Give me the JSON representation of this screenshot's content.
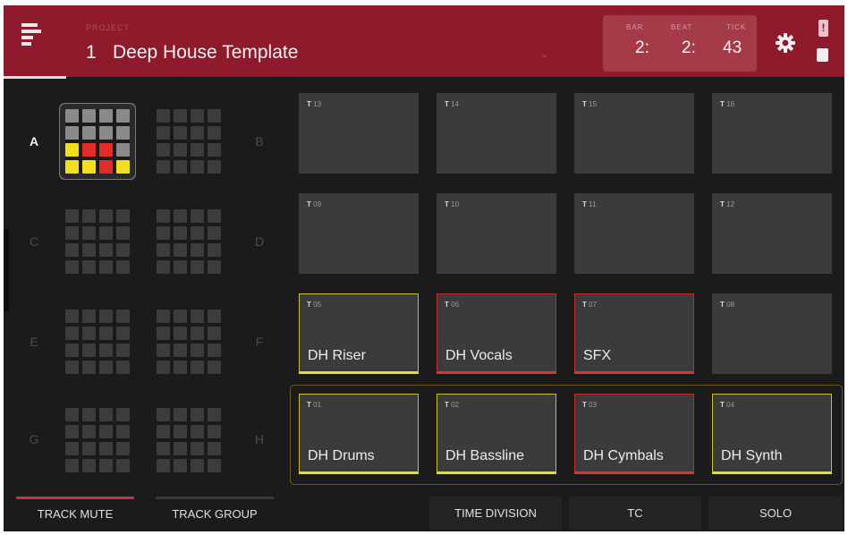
{
  "header": {
    "project_caption": "PROJECT",
    "project_number": "1",
    "project_name": "Deep House Template",
    "chevron": "⌄",
    "counter": {
      "bar_label": "BAR",
      "bar_value": "2:",
      "beat_label": "BEAT",
      "beat_value": "2:",
      "tick_label": "TICK",
      "tick_value": "43"
    },
    "alert_glyph": "!"
  },
  "banks": [
    {
      "letter": "A",
      "active": true
    },
    {
      "letter": "B",
      "active": false
    },
    {
      "letter": "C",
      "active": false
    },
    {
      "letter": "D",
      "active": false
    },
    {
      "letter": "E",
      "active": false
    },
    {
      "letter": "F",
      "active": false
    },
    {
      "letter": "G",
      "active": false
    },
    {
      "letter": "H",
      "active": false
    }
  ],
  "selected_bank_pad_colors": [
    "grey",
    "grey",
    "grey",
    "grey",
    "grey",
    "grey",
    "grey",
    "grey",
    "yellow",
    "red",
    "red",
    "grey",
    "yellow",
    "yellow",
    "red",
    "yellow"
  ],
  "pads": [
    {
      "t": "T",
      "num": "13",
      "name": "",
      "state": "off"
    },
    {
      "t": "T",
      "num": "14",
      "name": "",
      "state": "off"
    },
    {
      "t": "T",
      "num": "15",
      "name": "",
      "state": "off"
    },
    {
      "t": "T",
      "num": "16",
      "name": "",
      "state": "off"
    },
    {
      "t": "T",
      "num": "09",
      "name": "",
      "state": "off"
    },
    {
      "t": "T",
      "num": "10",
      "name": "",
      "state": "off"
    },
    {
      "t": "T",
      "num": "11",
      "name": "",
      "state": "off"
    },
    {
      "t": "T",
      "num": "12",
      "name": "",
      "state": "off"
    },
    {
      "t": "T",
      "num": "05",
      "name": "DH Riser",
      "state": "yellow"
    },
    {
      "t": "T",
      "num": "06",
      "name": "DH Vocals",
      "state": "red"
    },
    {
      "t": "T",
      "num": "07",
      "name": "SFX",
      "state": "red"
    },
    {
      "t": "T",
      "num": "08",
      "name": "",
      "state": "off"
    },
    {
      "t": "T",
      "num": "01",
      "name": "DH Drums",
      "state": "yellow"
    },
    {
      "t": "T",
      "num": "02",
      "name": "DH Bassline",
      "state": "yellow"
    },
    {
      "t": "T",
      "num": "03",
      "name": "DH Cymbals",
      "state": "red"
    },
    {
      "t": "T",
      "num": "04",
      "name": "DH Synth",
      "state": "yellow"
    }
  ],
  "footer": {
    "track_mute": "TRACK MUTE",
    "track_group": "TRACK GROUP",
    "time_division": "TIME DIVISION",
    "tc": "TC",
    "solo": "SOLO"
  },
  "colors": {
    "header_bg": "#8e1a2b",
    "pad_yellow": "#e6e027",
    "pad_red": "#e23232",
    "mute_indicator": "#c8323a"
  },
  "icons": [
    "menu-icon",
    "gear-icon",
    "alert-icon",
    "chip-icon"
  ]
}
